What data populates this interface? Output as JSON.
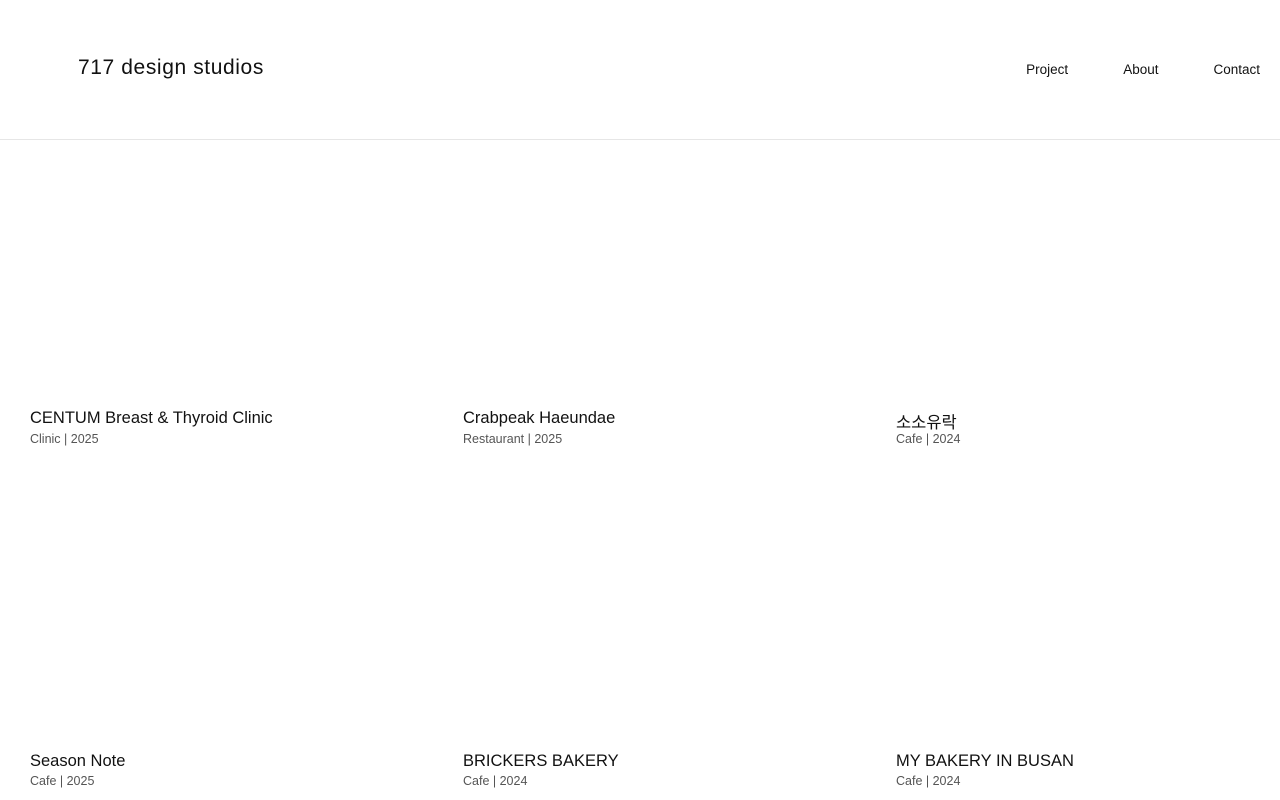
{
  "header": {
    "logo": "717 design studios",
    "nav": {
      "project": "Project",
      "about": "About",
      "contact": "Contact"
    }
  },
  "projects": [
    {
      "title": "CENTUM Breast & Thyroid Clinic",
      "meta": "Clinic |  2025"
    },
    {
      "title": "Crabpeak Haeundae",
      "meta": "Restaurant  |  2025"
    },
    {
      "title": "소소유락",
      "meta": "Cafe  |  2024"
    },
    {
      "title": "Season Note",
      "meta": "Cafe  |  2025"
    },
    {
      "title": "BRICKERS BAKERY",
      "meta": "Cafe  |  2024"
    },
    {
      "title": "MY BAKERY IN BUSAN",
      "meta": "Cafe |  2024"
    }
  ]
}
